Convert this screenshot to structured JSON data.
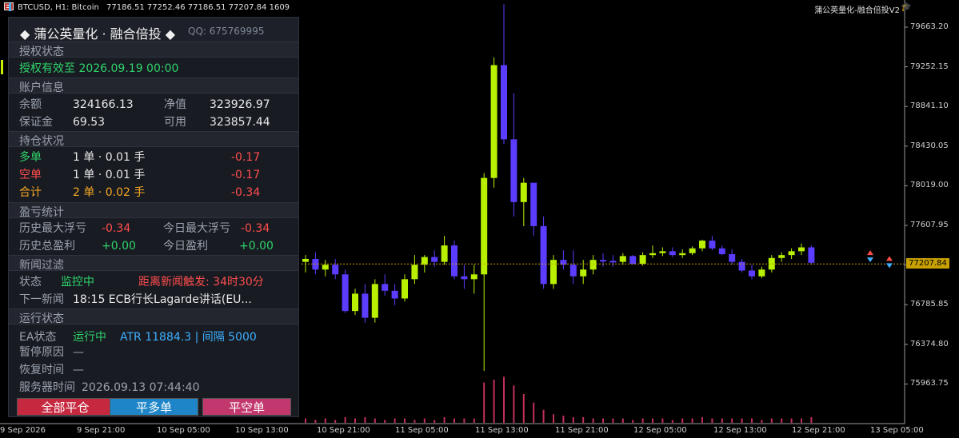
{
  "header": {
    "symbol_info": "BTCUSD, H1:  Bitcoin",
    "ohlc": "77186.51 77252.46 77186.51 77207.84",
    "count": "1609",
    "ea_name": "蒲公英量化-融合倍投V2"
  },
  "price_axis": {
    "labels": [
      "79663.20",
      "79252.15",
      "78841.10",
      "78430.05",
      "78019.00",
      "77607.95",
      "77196.90",
      "76785.85",
      "76374.80",
      "75963.75"
    ],
    "current_price": "77207.84"
  },
  "time_axis": {
    "labels": [
      "9 Sep 2026",
      "9 Sep 21:00",
      "10 Sep 05:00",
      "10 Sep 13:00",
      "10 Sep 21:00",
      "11 Sep 05:00",
      "11 Sep 13:00",
      "11 Sep 21:00",
      "12 Sep 05:00",
      "12 Sep 13:00",
      "12 Sep 21:00",
      "13 Sep 05:00"
    ]
  },
  "colors": {
    "bull": "#b8f000",
    "bear": "#5a3dff",
    "background": "#000000",
    "price_tag": "#c8a000",
    "volume": "#c2305a"
  },
  "panel": {
    "title": "◆ 蒲公英量化 · 融合倍投 ◆",
    "qq": "QQ: 675769995",
    "auth": {
      "section": "授权状态",
      "status": "授权有效至 2026.09.19 00:00"
    },
    "account": {
      "section": "账户信息",
      "balance_label": "余额",
      "balance": "324166.13",
      "equity_label": "净值",
      "equity": "323926.97",
      "margin_label": "保证金",
      "margin": "69.53",
      "free_label": "可用",
      "free": "323857.44"
    },
    "positions": {
      "section": "持仓状况",
      "long_label": "多单",
      "long_qty": "1 单 · 0.01 手",
      "long_pl": "-0.17",
      "short_label": "空单",
      "short_qty": "1 单 · 0.01 手",
      "short_pl": "-0.17",
      "total_label": "合计",
      "total_qty": "2 单 · 0.02 手",
      "total_pl": "-0.34"
    },
    "stats": {
      "section": "盈亏统计",
      "hist_max_label": "历史最大浮亏",
      "hist_max": "-0.34",
      "today_max_label": "今日最大浮亏",
      "today_max": "-0.34",
      "hist_total_label": "历史总盈利",
      "hist_total": "+0.00",
      "today_label": "今日盈利",
      "today": "+0.00"
    },
    "news": {
      "section": "新闻过滤",
      "status_label": "状态",
      "status": "监控中",
      "countdown": "距离新闻触发: 34时30分",
      "next_label": "下一新闻",
      "next": "18:15 ECB行长Lagarde讲话(EU..."
    },
    "run": {
      "section": "运行状态",
      "ea_label": "EA状态",
      "ea_status": "运行中",
      "atr": "ATR 11884.3 | 间隔 5000",
      "pause_label": "暂停原因",
      "pause": "—",
      "resume_label": "恢复时间",
      "resume": "—",
      "server_label": "服务器时间",
      "server": "2026.09.13 07:44:40"
    },
    "buttons": {
      "close_all": "全部平仓",
      "close_long": "平多单",
      "close_short": "平空单"
    }
  },
  "chart_data": {
    "type": "candlestick",
    "symbol": "BTCUSD",
    "timeframe": "H1",
    "ylim": [
      75800,
      79800
    ],
    "candles": [
      [
        77230,
        77300,
        77120,
        77260
      ],
      [
        77260,
        77330,
        77100,
        77150
      ],
      [
        77150,
        77250,
        77080,
        77200
      ],
      [
        77200,
        77260,
        77050,
        77100
      ],
      [
        77100,
        77150,
        76700,
        76720
      ],
      [
        76720,
        76950,
        76680,
        76900
      ],
      [
        76900,
        77000,
        76600,
        76650
      ],
      [
        76650,
        77050,
        76600,
        77000
      ],
      [
        77000,
        77100,
        76880,
        76930
      ],
      [
        76930,
        77000,
        76780,
        76850
      ],
      [
        76850,
        77100,
        76820,
        77050
      ],
      [
        77050,
        77300,
        77000,
        77200
      ],
      [
        77200,
        77300,
        77120,
        77280
      ],
      [
        77280,
        77350,
        77180,
        77230
      ],
      [
        77230,
        77500,
        77200,
        77400
      ],
      [
        77400,
        77450,
        77050,
        77080
      ],
      [
        77080,
        77200,
        76950,
        77050
      ],
      [
        77050,
        77200,
        76900,
        77100
      ],
      [
        77100,
        78150,
        76100,
        78100
      ],
      [
        78100,
        79350,
        78000,
        79270
      ],
      [
        79270,
        79900,
        78450,
        78500
      ],
      [
        78500,
        78980,
        77700,
        77850
      ],
      [
        77850,
        78100,
        77600,
        78050
      ],
      [
        78050,
        78000,
        77500,
        77600
      ],
      [
        77600,
        77700,
        76950,
        77000
      ],
      [
        77000,
        77300,
        76950,
        77250
      ],
      [
        77250,
        77350,
        77150,
        77200
      ],
      [
        77200,
        77350,
        77000,
        77080
      ],
      [
        77080,
        77250,
        77000,
        77150
      ],
      [
        77150,
        77300,
        77100,
        77250
      ],
      [
        77250,
        77320,
        77180,
        77240
      ],
      [
        77240,
        77300,
        77180,
        77230
      ],
      [
        77230,
        77320,
        77200,
        77290
      ],
      [
        77290,
        77300,
        77200,
        77210
      ],
      [
        77210,
        77330,
        77190,
        77300
      ],
      [
        77300,
        77400,
        77270,
        77320
      ],
      [
        77320,
        77380,
        77290,
        77340
      ],
      [
        77340,
        77380,
        77280,
        77300
      ],
      [
        77300,
        77360,
        77270,
        77320
      ],
      [
        77320,
        77390,
        77300,
        77370
      ],
      [
        77370,
        77460,
        77340,
        77450
      ],
      [
        77450,
        77500,
        77350,
        77370
      ],
      [
        77370,
        77400,
        77300,
        77310
      ],
      [
        77310,
        77360,
        77200,
        77230
      ],
      [
        77230,
        77260,
        77120,
        77140
      ],
      [
        77140,
        77200,
        77050,
        77080
      ],
      [
        77080,
        77180,
        77060,
        77150
      ],
      [
        77150,
        77300,
        77120,
        77270
      ],
      [
        77270,
        77330,
        77230,
        77300
      ],
      [
        77300,
        77370,
        77260,
        77340
      ],
      [
        77340,
        77420,
        77300,
        77380
      ],
      [
        77380,
        77400,
        77200,
        77220
      ]
    ],
    "volumes": [
      3,
      2,
      3,
      2,
      4,
      3,
      4,
      3,
      2,
      3,
      3,
      2,
      3,
      2,
      4,
      3,
      3,
      3,
      28,
      30,
      32,
      26,
      20,
      14,
      9,
      6,
      5,
      4,
      4,
      3,
      3,
      3,
      3,
      2,
      3,
      3,
      3,
      2,
      3,
      3,
      4,
      3,
      3,
      3,
      3,
      3,
      2,
      3,
      3,
      3,
      3,
      4
    ]
  }
}
